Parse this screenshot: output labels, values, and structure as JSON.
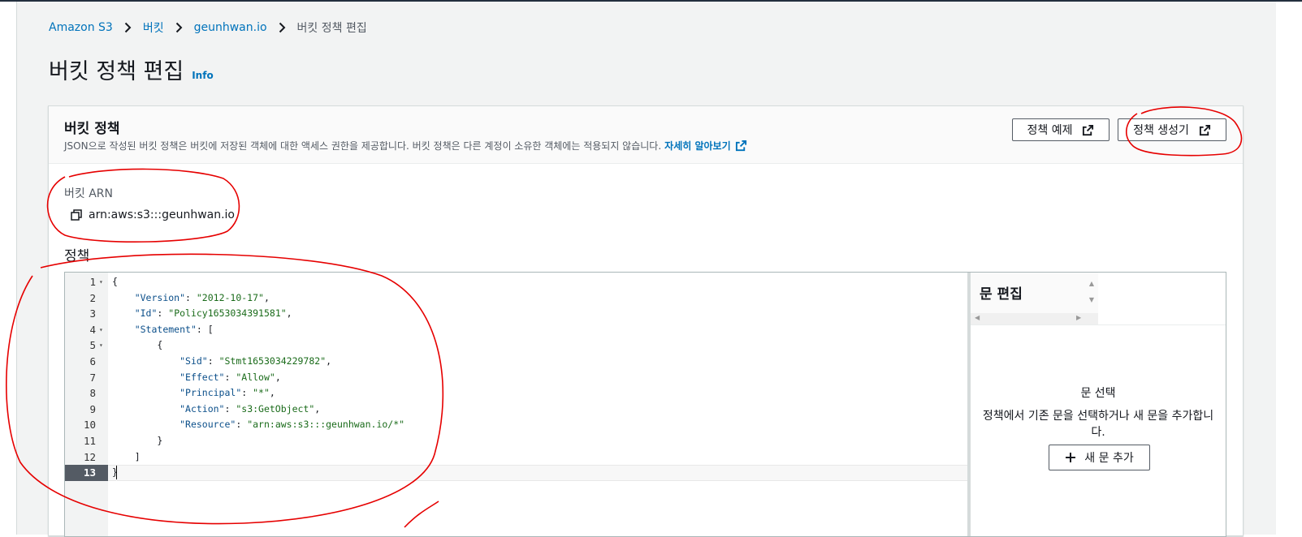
{
  "breadcrumb": {
    "items": [
      "Amazon S3",
      "버킷",
      "geunhwan.io",
      "버킷 정책 편집"
    ]
  },
  "page": {
    "title": "버킷 정책 편집",
    "info_label": "Info"
  },
  "panel": {
    "title": "버킷 정책",
    "description": "JSON으로 작성된 버킷 정책은 버킷에 저장된 객체에 대한 액세스 권한을 제공합니다. 버킷 정책은 다른 계정이 소유한 객체에는 적용되지 않습니다.",
    "learn_more": "자세히 알아보기",
    "example_button": "정책 예제",
    "generator_button": "정책 생성기"
  },
  "arn": {
    "label": "버킷 ARN",
    "value": "arn:aws:s3:::geunhwan.io"
  },
  "policy": {
    "label": "정책",
    "line_numbers": [
      "1",
      "2",
      "3",
      "4",
      "5",
      "6",
      "7",
      "8",
      "9",
      "10",
      "11",
      "12",
      "13"
    ],
    "lines": [
      "{",
      "    \"Version\": \"2012-10-17\",",
      "    \"Id\": \"Policy1653034391581\",",
      "    \"Statement\": [",
      "        {",
      "            \"Sid\": \"Stmt1653034229782\",",
      "            \"Effect\": \"Allow\",",
      "            \"Principal\": \"*\",",
      "            \"Action\": \"s3:GetObject\",",
      "            \"Resource\": \"arn:aws:s3:::geunhwan.io/*\"",
      "        }",
      "    ]",
      "}"
    ]
  },
  "statement_panel": {
    "title": "문 편집",
    "empty_title": "문 선택",
    "empty_desc": "정책에서 기존 문을 선택하거나 새 문을 추가합니다.",
    "add_button": "새 문 추가"
  },
  "colors": {
    "link": "#0073bb",
    "annotation": "#e60000",
    "key": "#0b4f8a",
    "string": "#1a6b1a"
  }
}
